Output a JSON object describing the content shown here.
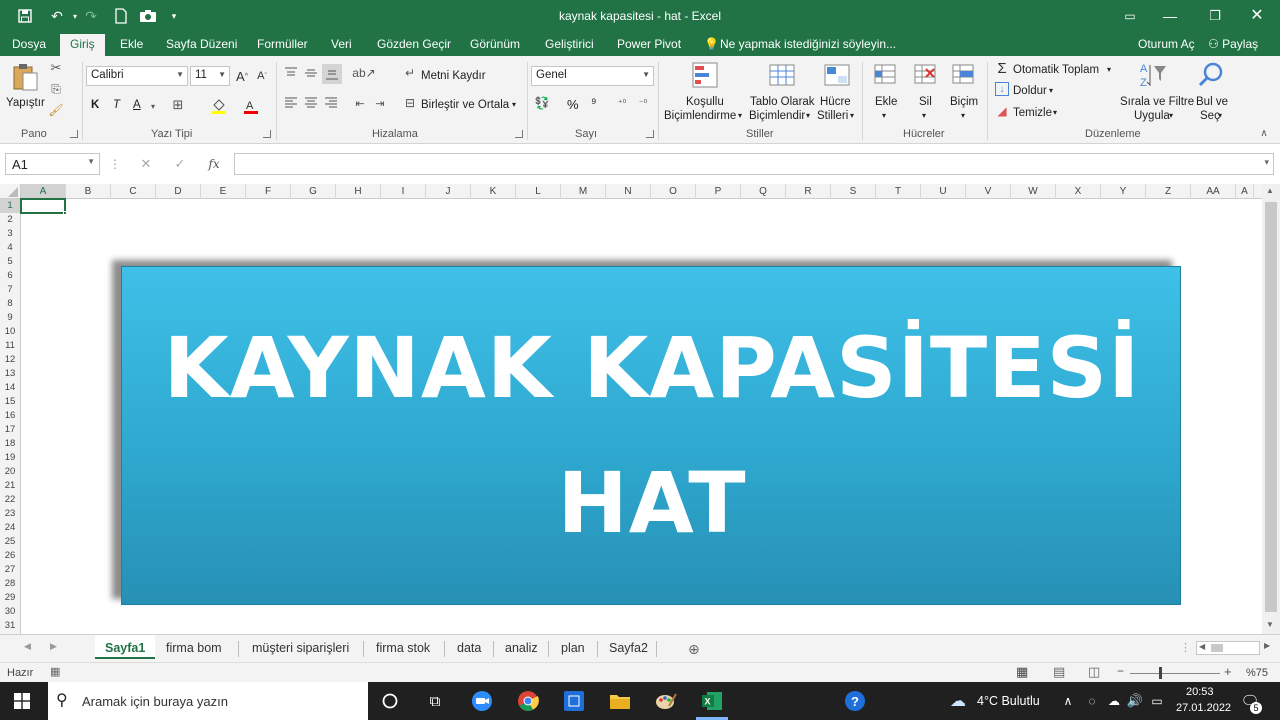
{
  "window": {
    "title": "kaynak kapasitesi - hat - Excel"
  },
  "menu_tabs": [
    "Dosya",
    "Giriş",
    "Ekle",
    "Sayfa Düzeni",
    "Formüller",
    "Veri",
    "Gözden Geçir",
    "Görünüm",
    "Geliştirici",
    "Power Pivot"
  ],
  "tell_me": "Ne yapmak istediğinizi söyleyin...",
  "account": {
    "signin": "Oturum Aç",
    "share": "Paylaş"
  },
  "ribbon": {
    "clipboard": {
      "paste": "Yapıştır",
      "label": "Pano"
    },
    "font": {
      "name": "Calibri",
      "size": "11",
      "bold": "K",
      "italic": "T",
      "underline": "A",
      "label": "Yazı Tipi"
    },
    "alignment": {
      "wrap": "Metni Kaydır",
      "merge": "Birleştir ve Ortala",
      "label": "Hizalama"
    },
    "number": {
      "format": "Genel",
      "percent": "%",
      "comma": "⁹",
      "label": "Sayı"
    },
    "styles": {
      "conditional_1": "Koşullu",
      "conditional_2": "Biçimlendirme",
      "table_1": "Tablo Olarak",
      "table_2": "Biçimlendir",
      "cell_1": "Hücre",
      "cell_2": "Stilleri",
      "label": "Stiller"
    },
    "cells": {
      "insert": "Ekle",
      "delete": "Sil",
      "format": "Biçim",
      "label": "Hücreler"
    },
    "editing": {
      "autosum": "Otomatik Toplam",
      "fill": "Doldur",
      "clear": "Temizle",
      "sort_1": "Sırala ve Filtre",
      "sort_2": "Uygula",
      "find_1": "Bul ve",
      "find_2": "Seç",
      "label": "Düzenleme"
    }
  },
  "formula_bar": {
    "name_box": "A1",
    "fx": "fx",
    "value": ""
  },
  "columns": [
    "A",
    "B",
    "C",
    "D",
    "E",
    "F",
    "G",
    "H",
    "I",
    "J",
    "K",
    "L",
    "M",
    "N",
    "O",
    "P",
    "Q",
    "R",
    "S",
    "T",
    "U",
    "V",
    "W",
    "X",
    "Y",
    "Z",
    "AA",
    "A"
  ],
  "rows": [
    "1",
    "2",
    "3",
    "4",
    "5",
    "6",
    "7",
    "8",
    "9",
    "10",
    "11",
    "12",
    "13",
    "14",
    "15",
    "16",
    "17",
    "18",
    "19",
    "20",
    "21",
    "22",
    "23",
    "24",
    "25",
    "26",
    "27",
    "28",
    "29",
    "30",
    "31"
  ],
  "shape": {
    "line1": "KAYNAK KAPASİTESİ",
    "line2": "HAT",
    "fill": "#34b4dc"
  },
  "sheets": [
    "Sayfa1",
    "firma bom",
    "müşteri siparişleri",
    "firma stok",
    "data",
    "analiz",
    "plan",
    "Sayfa2"
  ],
  "active_sheet": "Sayfa1",
  "status": {
    "ready": "Hazır",
    "zoom": "%75"
  },
  "taskbar": {
    "search_placeholder": "Aramak için buraya yazın",
    "weather": "4°C Bulutlu",
    "time": "20:53",
    "date": "27.01.2022",
    "notifications": "5"
  },
  "colors": {
    "excel_green": "#217346",
    "taskbar": "#202020"
  }
}
